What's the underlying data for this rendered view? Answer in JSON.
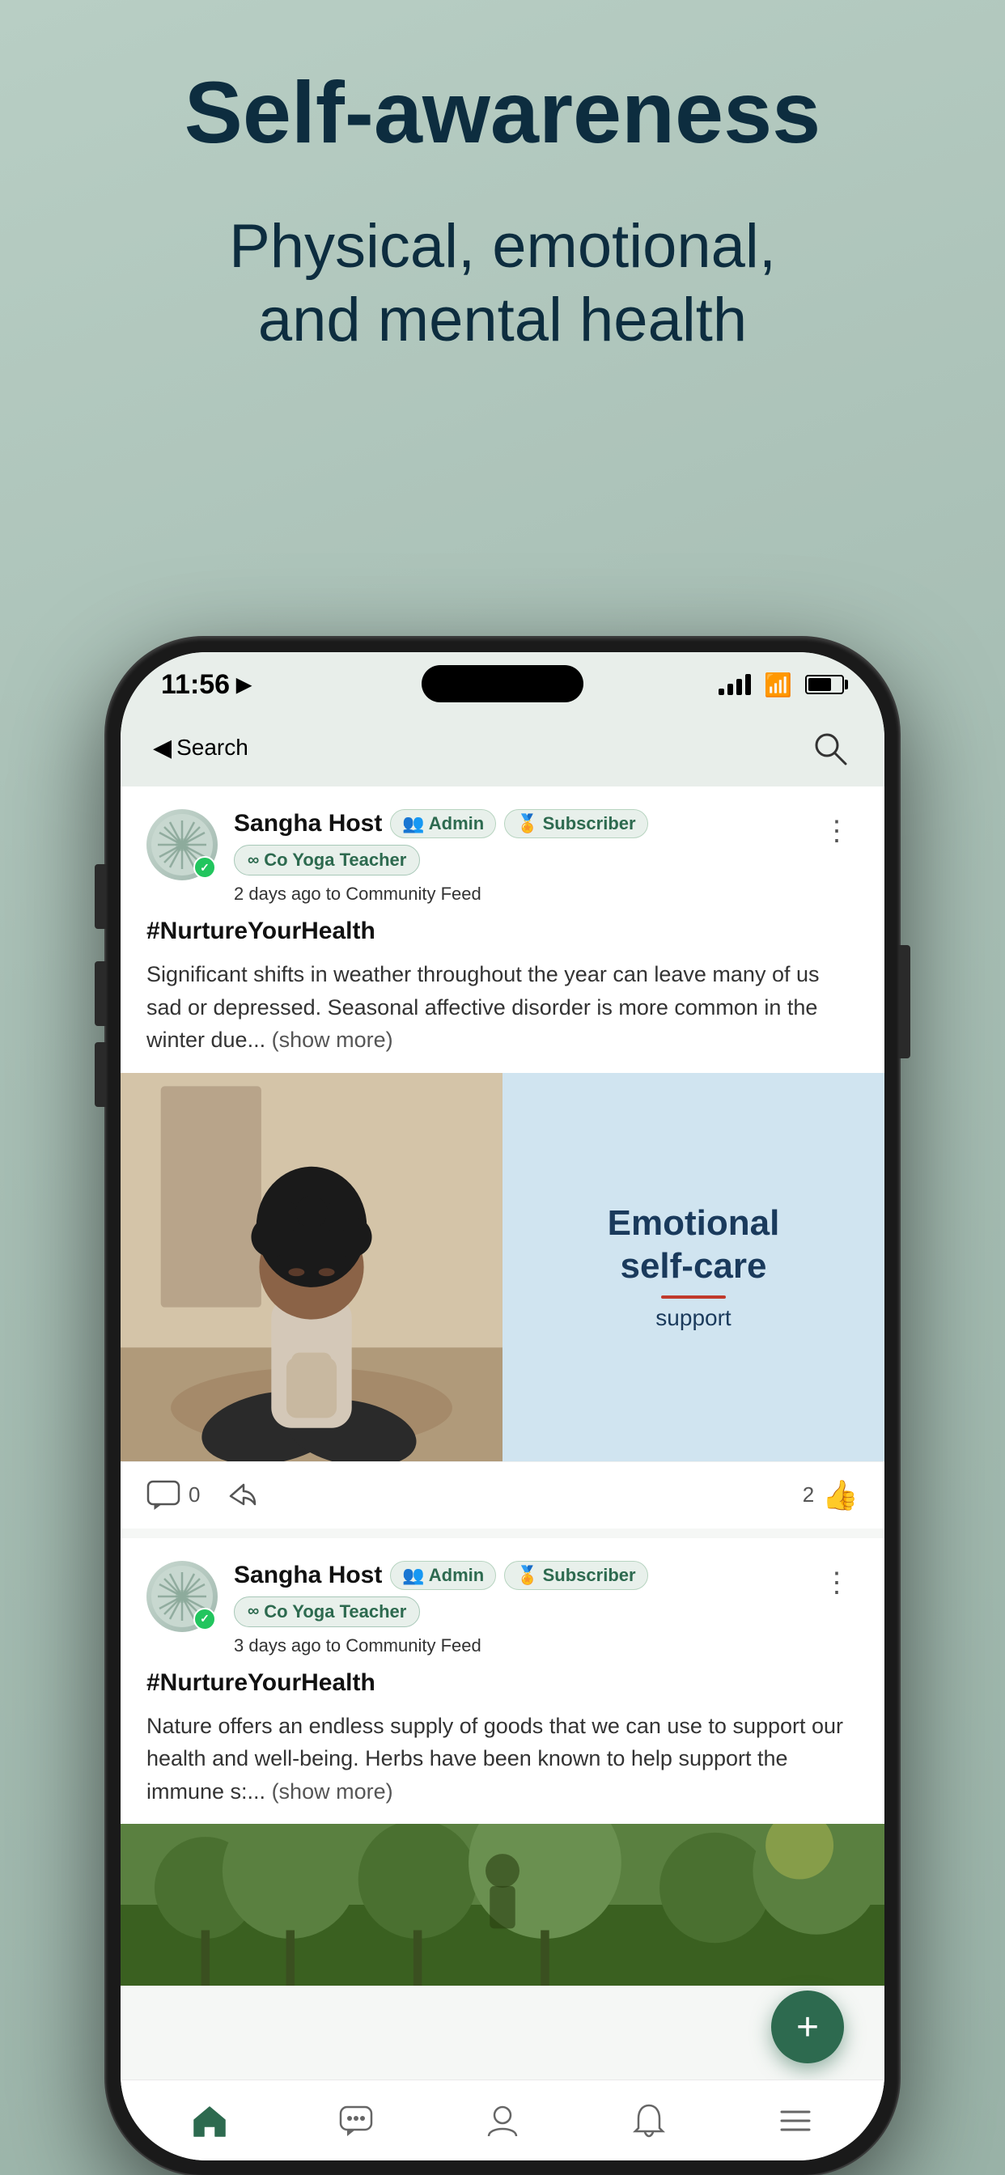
{
  "hero": {
    "title": "Self-awareness",
    "subtitle_line1": "Physical, emotional,",
    "subtitle_line2": "and mental health"
  },
  "status_bar": {
    "time": "11:56",
    "back_label": "Search"
  },
  "post1": {
    "author": "Sangha Host",
    "badge_admin": "Admin",
    "badge_subscriber": "Subscriber",
    "badge_role": "Co Yoga Teacher",
    "time_ago": "2 days ago",
    "feed": "Community Feed",
    "tag": "#NurtureYourHealth",
    "body": "Significant shifts in weather throughout the year can leave many of us sad or depressed. Seasonal affective disorder is more common in the winter due...",
    "show_more": "(show more)",
    "likes": "2",
    "comments": "0",
    "image_text_line1": "Emotional",
    "image_text_line2": "self-care",
    "image_text_line3": "support"
  },
  "post2": {
    "author": "Sangha Host",
    "badge_admin": "Admin",
    "badge_subscriber": "Subscriber",
    "badge_role": "Co Yoga Teacher",
    "time_ago": "3 days ago",
    "feed": "Community Feed",
    "tag": "#NurtureYourHealth",
    "body": "Nature offers an endless supply of goods that we can use to support our health and well-being. Herbs have been known to help support the immune s:...",
    "show_more": "(show more)"
  },
  "bottom_nav": {
    "items": [
      "home",
      "chat",
      "profile",
      "bell",
      "menu"
    ]
  },
  "fab_label": "+",
  "icons": {
    "admin_icon": "👥",
    "subscriber_icon": "🏅",
    "infinity": "∞",
    "search": "🔍",
    "menu_dots": "⋮",
    "home": "⌂",
    "chat": "💬",
    "person": "👤",
    "bell": "🔔",
    "hamburger": "≡",
    "checkmark": "✓",
    "thumbsup": "👍",
    "share": "↗"
  }
}
